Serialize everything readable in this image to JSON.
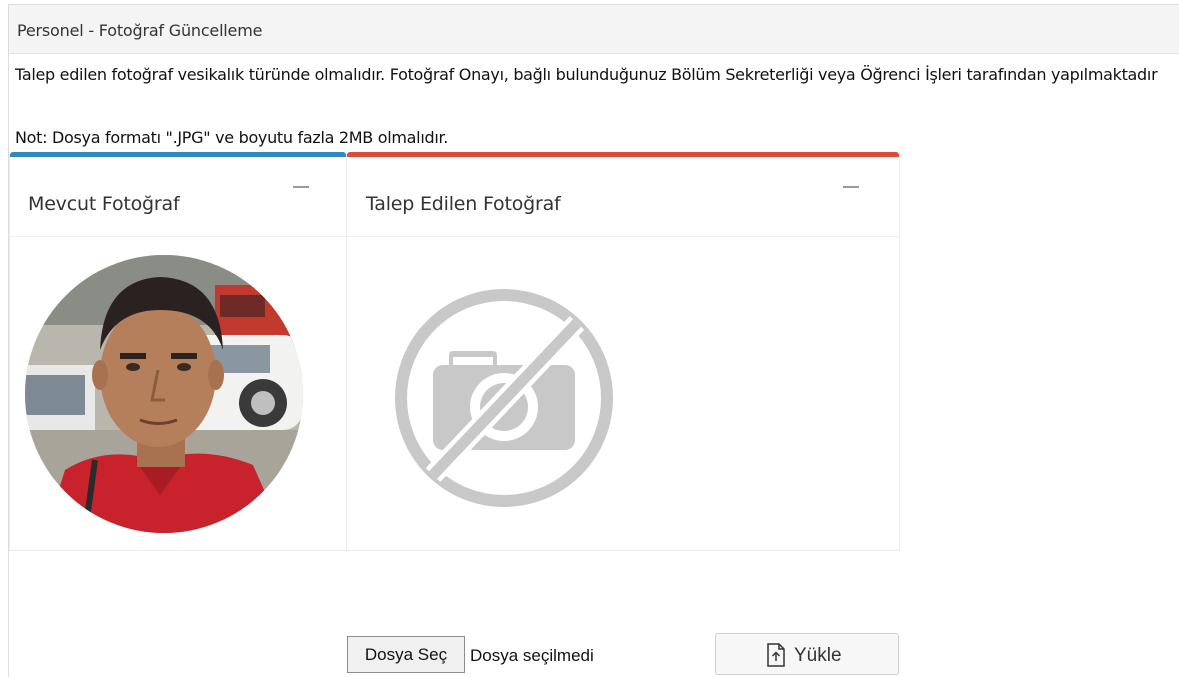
{
  "window": {
    "title": "Personel - Fotoğraf Güncelleme"
  },
  "info": {
    "description": "Talep edilen fotoğraf vesikalık türünde olmalıdır. Fotoğraf Onayı, bağlı bulunduğunuz Bölüm Sekreterliği veya Öğrenci İşleri tarafından yapılmaktadır",
    "note": "Not: Dosya formatı \".JPG\" ve boyutu fazla 2MB olmalıdır."
  },
  "panels": {
    "current": {
      "title": "Mevcut Fotoğraf",
      "accent": "#2f8ac1",
      "icon": "person-photo"
    },
    "requested": {
      "title": "Talep Edilen Fotoğraf",
      "accent": "#dd4b39",
      "icon": "no-photo-icon"
    }
  },
  "upload": {
    "choose_file_label": "Dosya Seç",
    "file_status": "Dosya seçilmedi",
    "upload_label": "Yükle",
    "upload_icon": "file-upload-icon"
  }
}
